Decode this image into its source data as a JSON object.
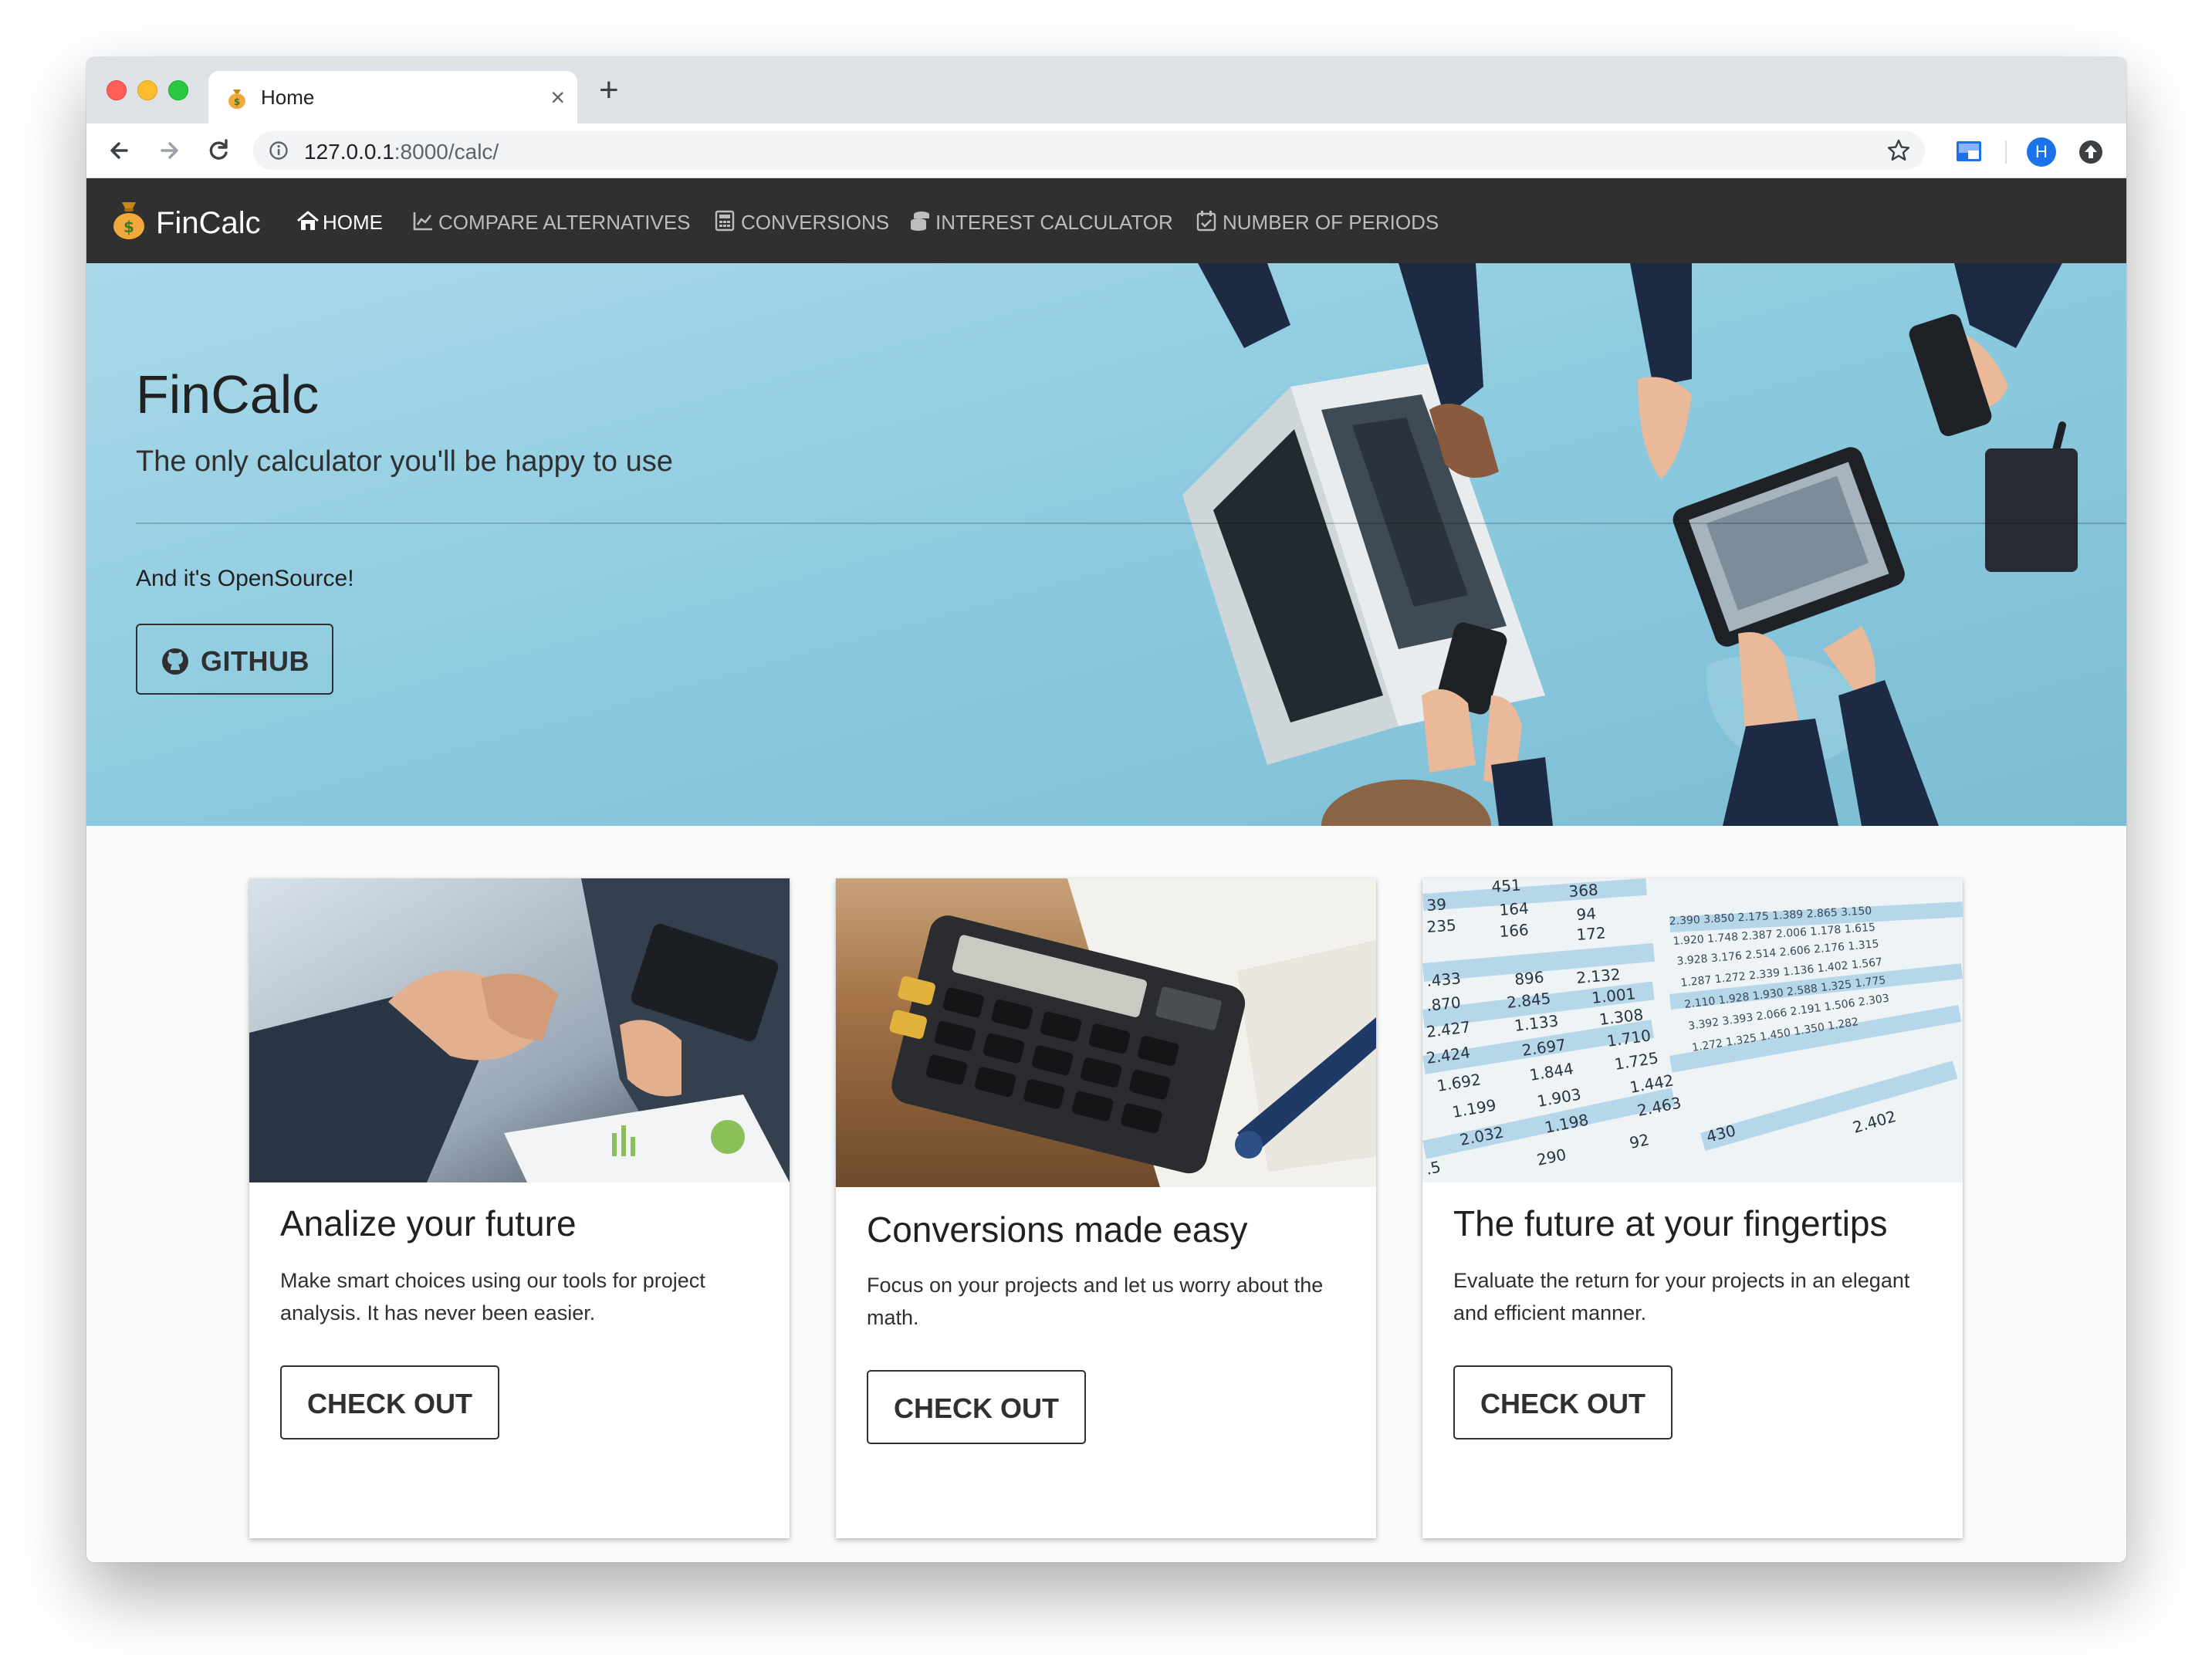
{
  "browser": {
    "tab_title": "Home",
    "url_host": "127.0.0.1",
    "url_rest": ":8000/calc/",
    "avatar_initial": "H",
    "new_tab": "+",
    "close_tab": "×"
  },
  "navbar": {
    "brand": "FinCalc",
    "links": [
      {
        "label": "HOME",
        "icon": "home-icon",
        "active": true
      },
      {
        "label": "COMPARE ALTERNATIVES",
        "icon": "line-chart-icon",
        "active": false
      },
      {
        "label": "CONVERSIONS",
        "icon": "calculator-icon",
        "active": false
      },
      {
        "label": "INTEREST CALCULATOR",
        "icon": "coins-icon",
        "active": false
      },
      {
        "label": "NUMBER OF PERIODS",
        "icon": "calendar-check-icon",
        "active": false
      }
    ]
  },
  "hero": {
    "title": "FinCalc",
    "subtitle": "The only calculator you'll be happy to use",
    "note": "And it's OpenSource!",
    "button_label": "GITHUB"
  },
  "cards": [
    {
      "title": "Analize your future",
      "text": "Make smart choices using our tools for project analysis. It has never been easier.",
      "button_label": "CHECK OUT"
    },
    {
      "title": "Conversions made easy",
      "text": "Focus on your projects and let us worry about the math.",
      "button_label": "CHECK OUT"
    },
    {
      "title": "The future at your fingertips",
      "text": "Evaluate the return for your projects in an elegant and efficient manner.",
      "button_label": "CHECK OUT"
    }
  ],
  "colors": {
    "navbar_bg": "#303030",
    "hero_bg": "#8cc8dc",
    "page_bg": "#fafafa"
  }
}
